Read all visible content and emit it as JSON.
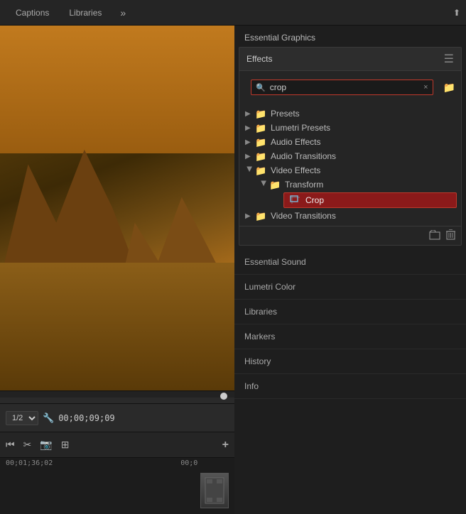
{
  "tabs": {
    "captions_label": "Captions",
    "libraries_label": "Libraries",
    "more_icon": "»",
    "export_icon": "⬆"
  },
  "essential_graphics": {
    "header": "Essential Graphics"
  },
  "effects_panel": {
    "title": "Effects",
    "menu_icon": "☰",
    "search_placeholder": "crop",
    "search_value": "crop",
    "clear_icon": "×",
    "folder_icon": "📂"
  },
  "tree": {
    "presets": "Presets",
    "lumetri_presets": "Lumetri Presets",
    "audio_effects": "Audio Effects",
    "audio_transitions": "Audio Transitions",
    "video_effects": "Video Effects",
    "transform": "Transform",
    "crop": "Crop",
    "video_transitions": "Video Transitions"
  },
  "timeline": {
    "fraction": "1/2",
    "timecode": "00;00;09;09",
    "time1": "00;01;36;02",
    "time2": "00;0"
  },
  "side_panels": [
    {
      "label": "Essential Sound"
    },
    {
      "label": "Lumetri Color"
    },
    {
      "label": "Libraries"
    },
    {
      "label": "Markers"
    },
    {
      "label": "History"
    },
    {
      "label": "Info"
    }
  ]
}
